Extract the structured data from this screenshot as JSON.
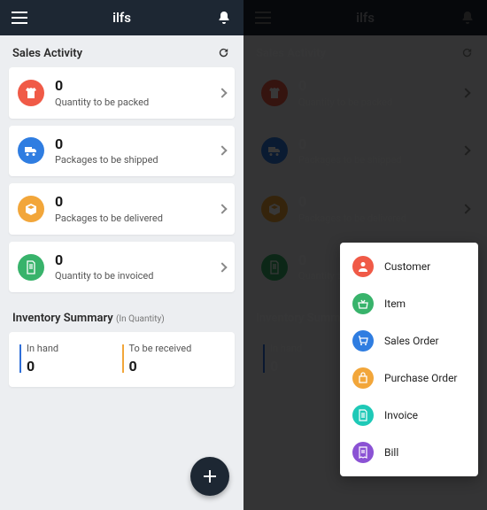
{
  "header": {
    "title": "ilfs"
  },
  "sales": {
    "title": "Sales Activity",
    "items": [
      {
        "value": "0",
        "label": "Quantity to be packed"
      },
      {
        "value": "0",
        "label": "Packages to be shipped"
      },
      {
        "value": "0",
        "label": "Packages to be delivered"
      },
      {
        "value": "0",
        "label": "Quantity to be invoiced"
      }
    ]
  },
  "inventory": {
    "title": "Inventory Summary",
    "subtitle": "(In Quantity)",
    "in_hand_label": "In hand",
    "in_hand_value": "0",
    "to_receive_label": "To be received",
    "to_receive_value": "0"
  },
  "fab_menu": {
    "items": [
      {
        "label": "Customer"
      },
      {
        "label": "Item"
      },
      {
        "label": "Sales Order"
      },
      {
        "label": "Purchase Order"
      },
      {
        "label": "Invoice"
      },
      {
        "label": "Bill"
      }
    ]
  }
}
